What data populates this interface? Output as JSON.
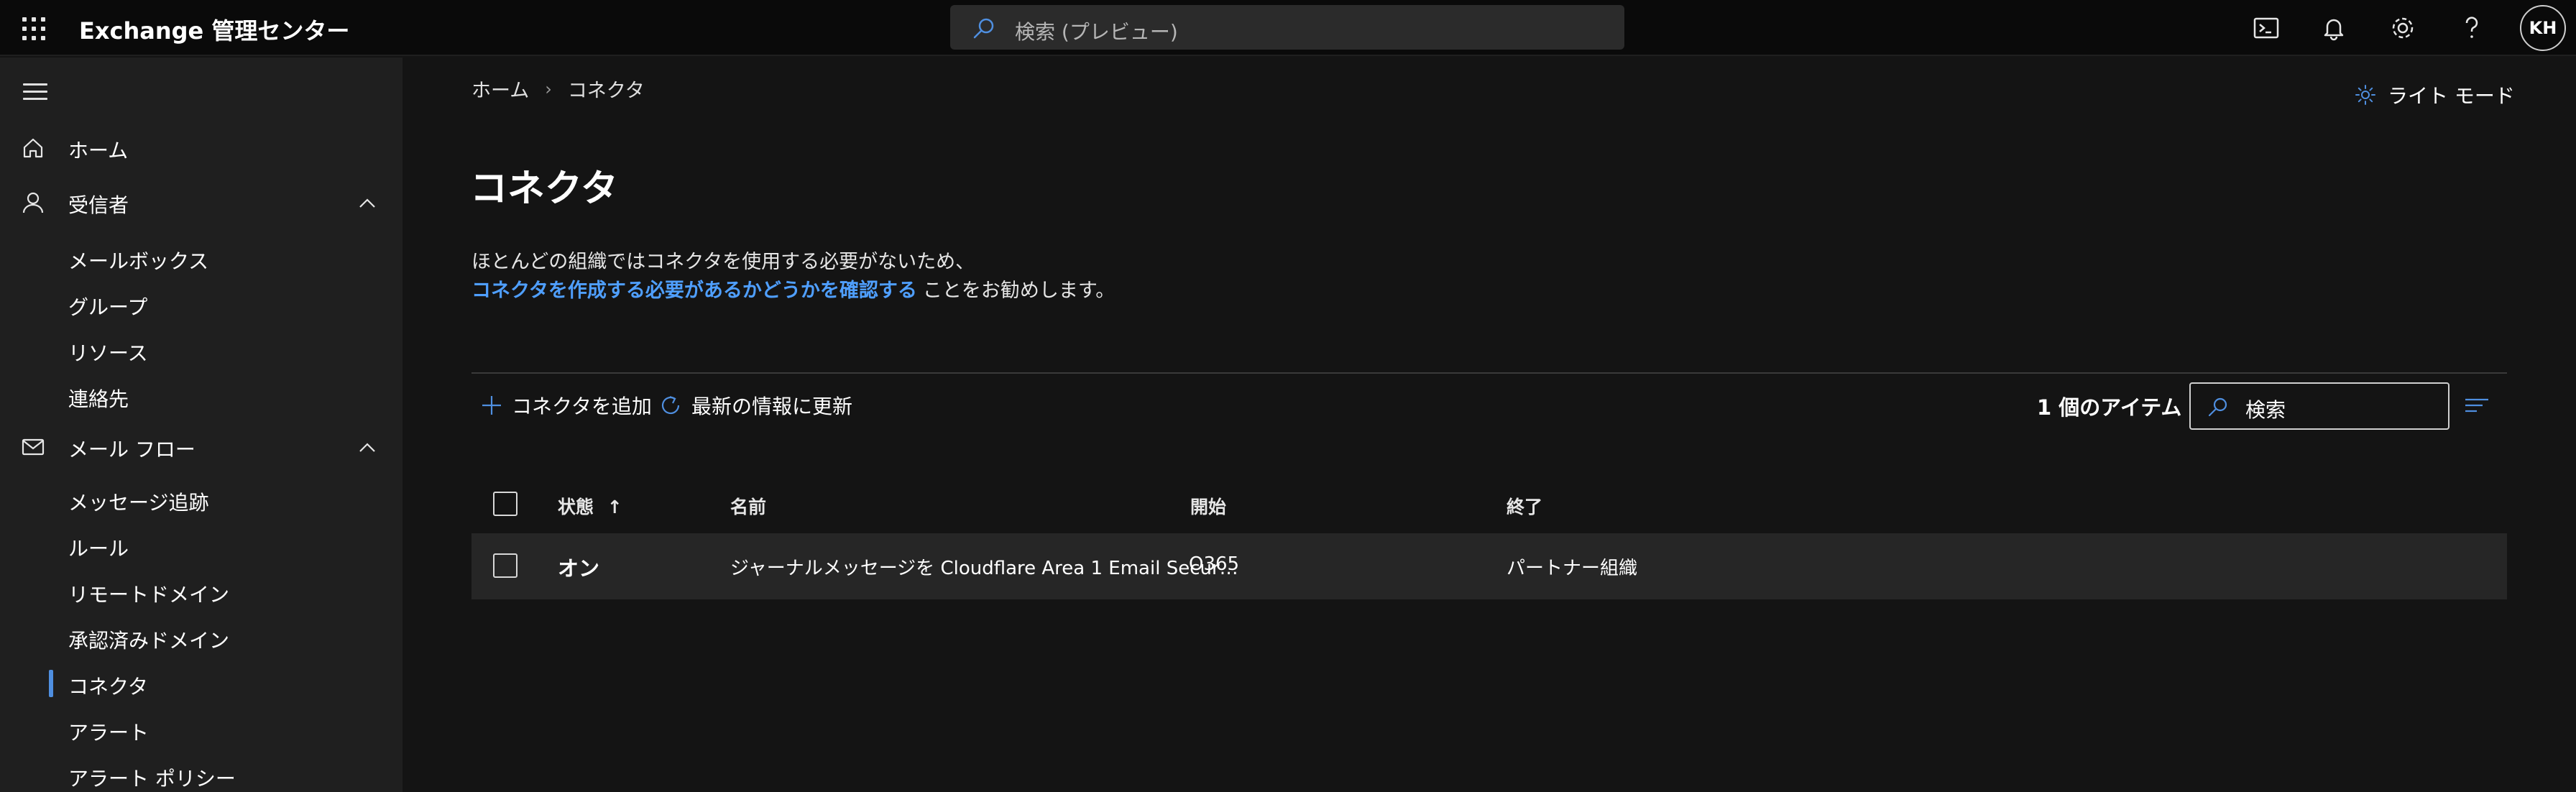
{
  "topbar": {
    "app_title": "Exchange 管理センター",
    "search_placeholder": "検索 (プレビュー)",
    "avatar_initials": "KH"
  },
  "sidebar": {
    "items": [
      {
        "label": "ホーム",
        "icon": "home-icon"
      },
      {
        "label": "受信者",
        "icon": "person-icon",
        "expanded": true,
        "children": [
          "メールボックス",
          "グループ",
          "リソース",
          "連絡先"
        ]
      },
      {
        "label": "メール フロー",
        "icon": "mail-icon",
        "expanded": true,
        "children": [
          "メッセージ追跡",
          "ルール",
          "リモートドメイン",
          "承認済みドメイン",
          "コネクタ",
          "アラート",
          "アラート ポリシー"
        ]
      }
    ],
    "selected": "コネクタ"
  },
  "breadcrumb": {
    "home": "ホーム",
    "current": "コネクタ"
  },
  "light_mode_label": "ライト モード",
  "page": {
    "title": "コネクタ",
    "desc_line1": "ほとんどの組織ではコネクタを使用する必要がないため、",
    "desc_link": "コネクタを作成する必要があるかどうかを確認する",
    "desc_suffix": "ことをお勧めします。"
  },
  "toolbar": {
    "add_label": "コネクタを追加",
    "refresh_label": "最新の情報に更新",
    "item_count": "1 個のアイテム",
    "search_placeholder": "検索"
  },
  "table": {
    "columns": [
      "状態",
      "名前",
      "開始",
      "終了"
    ],
    "sort_indicator": "↑",
    "rows": [
      {
        "status": "オン",
        "name": "ジャーナルメッセージを Cloudflare Area 1 Email Secur…",
        "from": "O365",
        "to": "パートナー組織"
      }
    ]
  },
  "colors": {
    "accent": "#4f8fe0",
    "link": "#4f9fff",
    "background": "#141414",
    "sidebar": "#1f1f1f",
    "topbar": "#0a0a0a"
  }
}
